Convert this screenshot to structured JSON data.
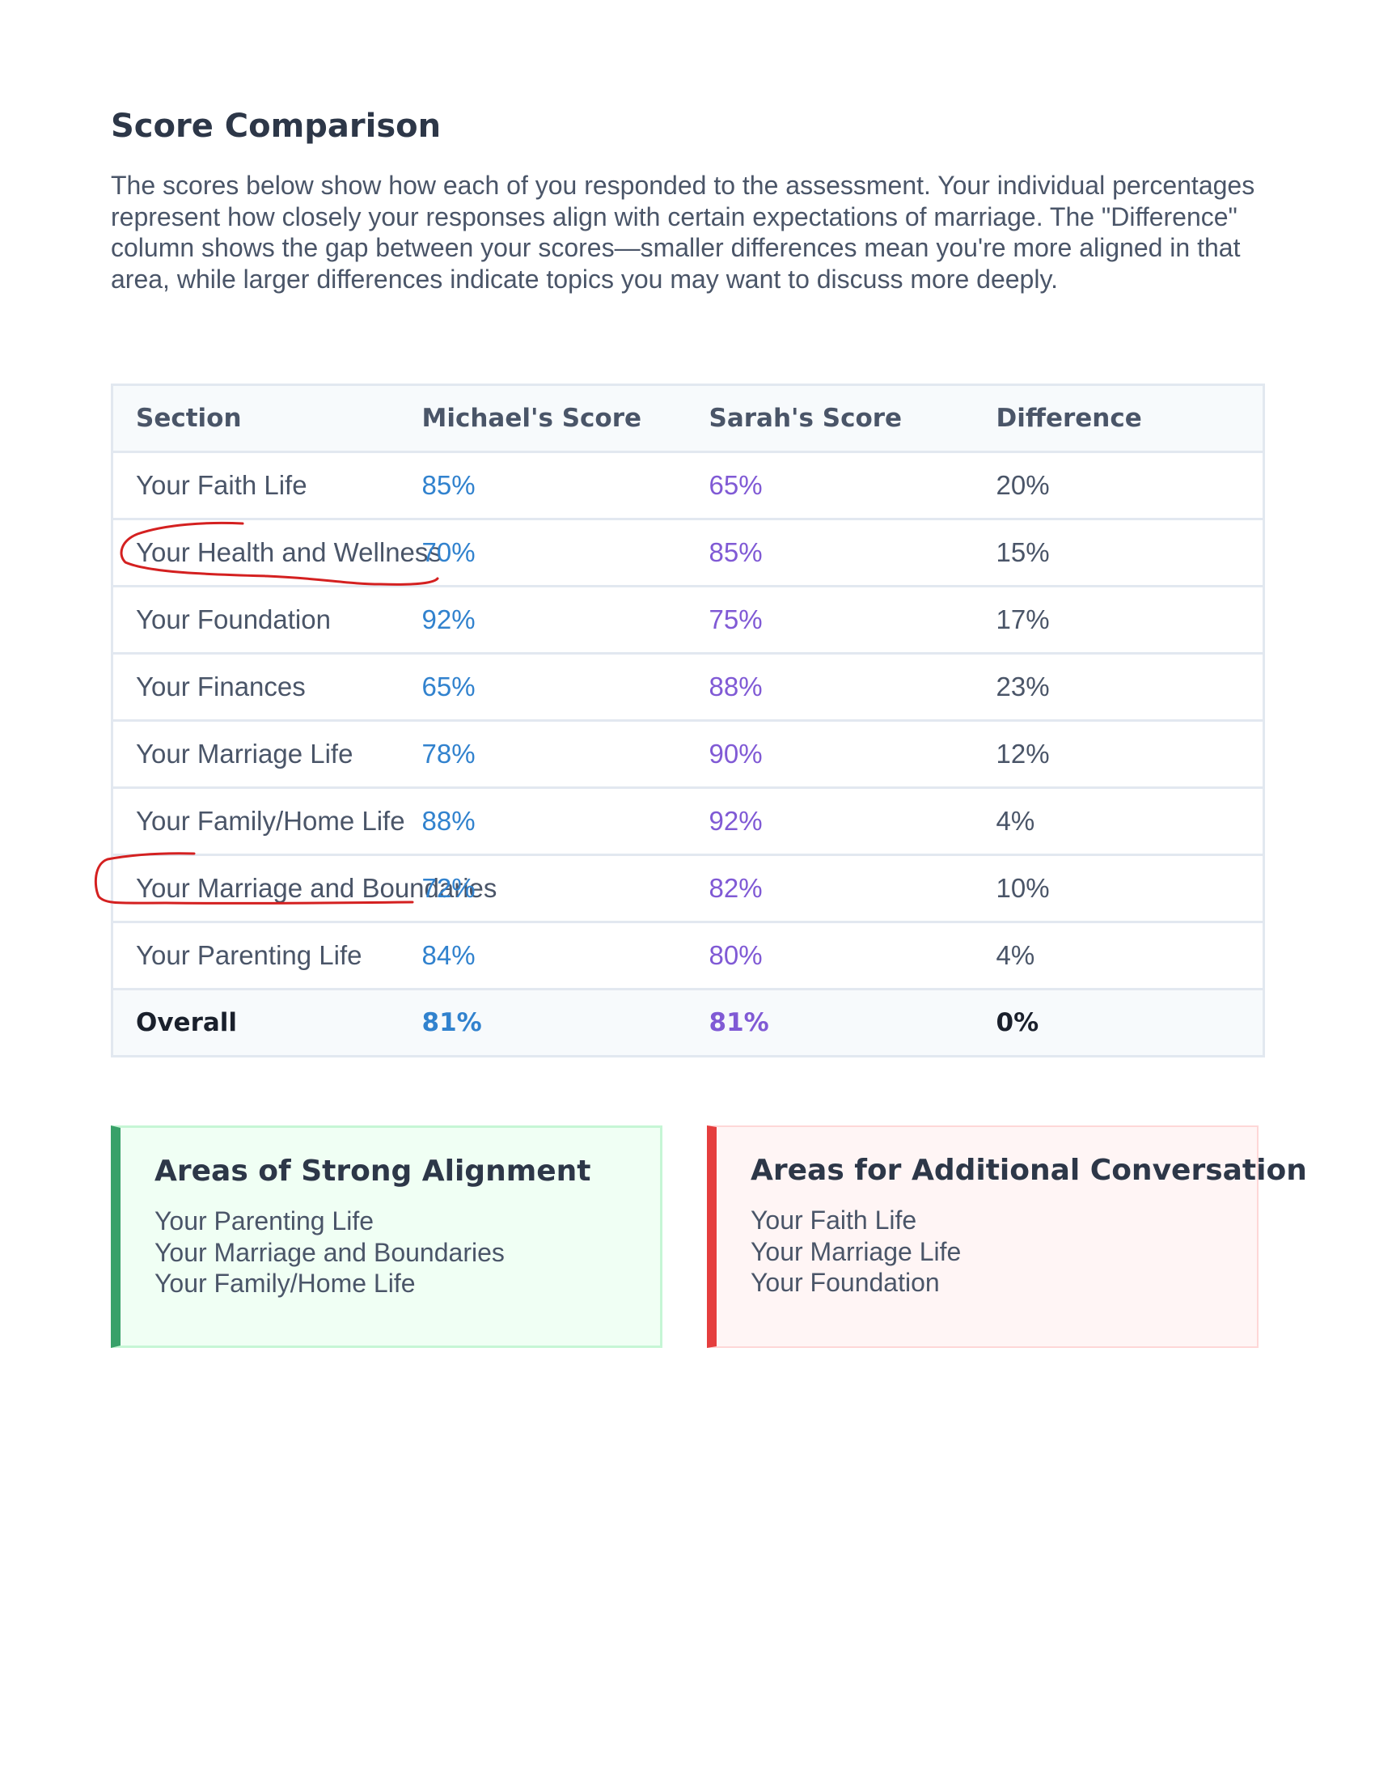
{
  "header": {
    "title": "Score Comparison"
  },
  "intro": {
    "text": "The scores below show how each of you responded to the assessment. Your individual percentages represent how closely your responses align with certain expectations of marriage. The \"Difference\" column shows the gap between your scores—smaller differences mean you're more aligned in that area, while larger differences indicate topics you may want to discuss more deeply."
  },
  "table": {
    "headers": {
      "section": "Section",
      "michael": "Michael's Score",
      "sarah": "Sarah's Score",
      "difference": "Difference"
    },
    "rows": [
      {
        "section": "Your Faith Life",
        "michael": "85%",
        "sarah": "65%",
        "difference": "20%"
      },
      {
        "section": "Your Health and Wellness",
        "michael": "70%",
        "sarah": "85%",
        "difference": "15%"
      },
      {
        "section": "Your Foundation",
        "michael": "92%",
        "sarah": "75%",
        "difference": "17%"
      },
      {
        "section": "Your Finances",
        "michael": "65%",
        "sarah": "88%",
        "difference": "23%"
      },
      {
        "section": "Your Marriage Life",
        "michael": "78%",
        "sarah": "90%",
        "difference": "12%"
      },
      {
        "section": "Your Family/Home Life",
        "michael": "88%",
        "sarah": "92%",
        "difference": "4%"
      },
      {
        "section": "Your Marriage and Boundaries",
        "michael": "72%",
        "sarah": "82%",
        "difference": "10%"
      },
      {
        "section": "Your Parenting Life",
        "michael": "84%",
        "sarah": "80%",
        "difference": "4%"
      }
    ],
    "overall": {
      "section": "Overall",
      "michael": "81%",
      "sarah": "81%",
      "difference": "0%"
    }
  },
  "strong_alignment": {
    "title": "Areas of Strong Alignment",
    "items": [
      "Your Parenting Life",
      "Your Marriage and Boundaries",
      "Your Family/Home Life"
    ]
  },
  "additional_conversation": {
    "title": "Areas for Additional Conversation",
    "items": [
      "Your Faith Life",
      "Your Marriage Life",
      "Your Foundation"
    ]
  },
  "colors": {
    "heading": "#2d3748",
    "body_text": "#4a5568",
    "michael_score": "#3182ce",
    "sarah_score": "#805ad5",
    "alignment_accent": "#38a169",
    "conversation_accent": "#e53e3e",
    "annotation_ink": "#d42020"
  }
}
